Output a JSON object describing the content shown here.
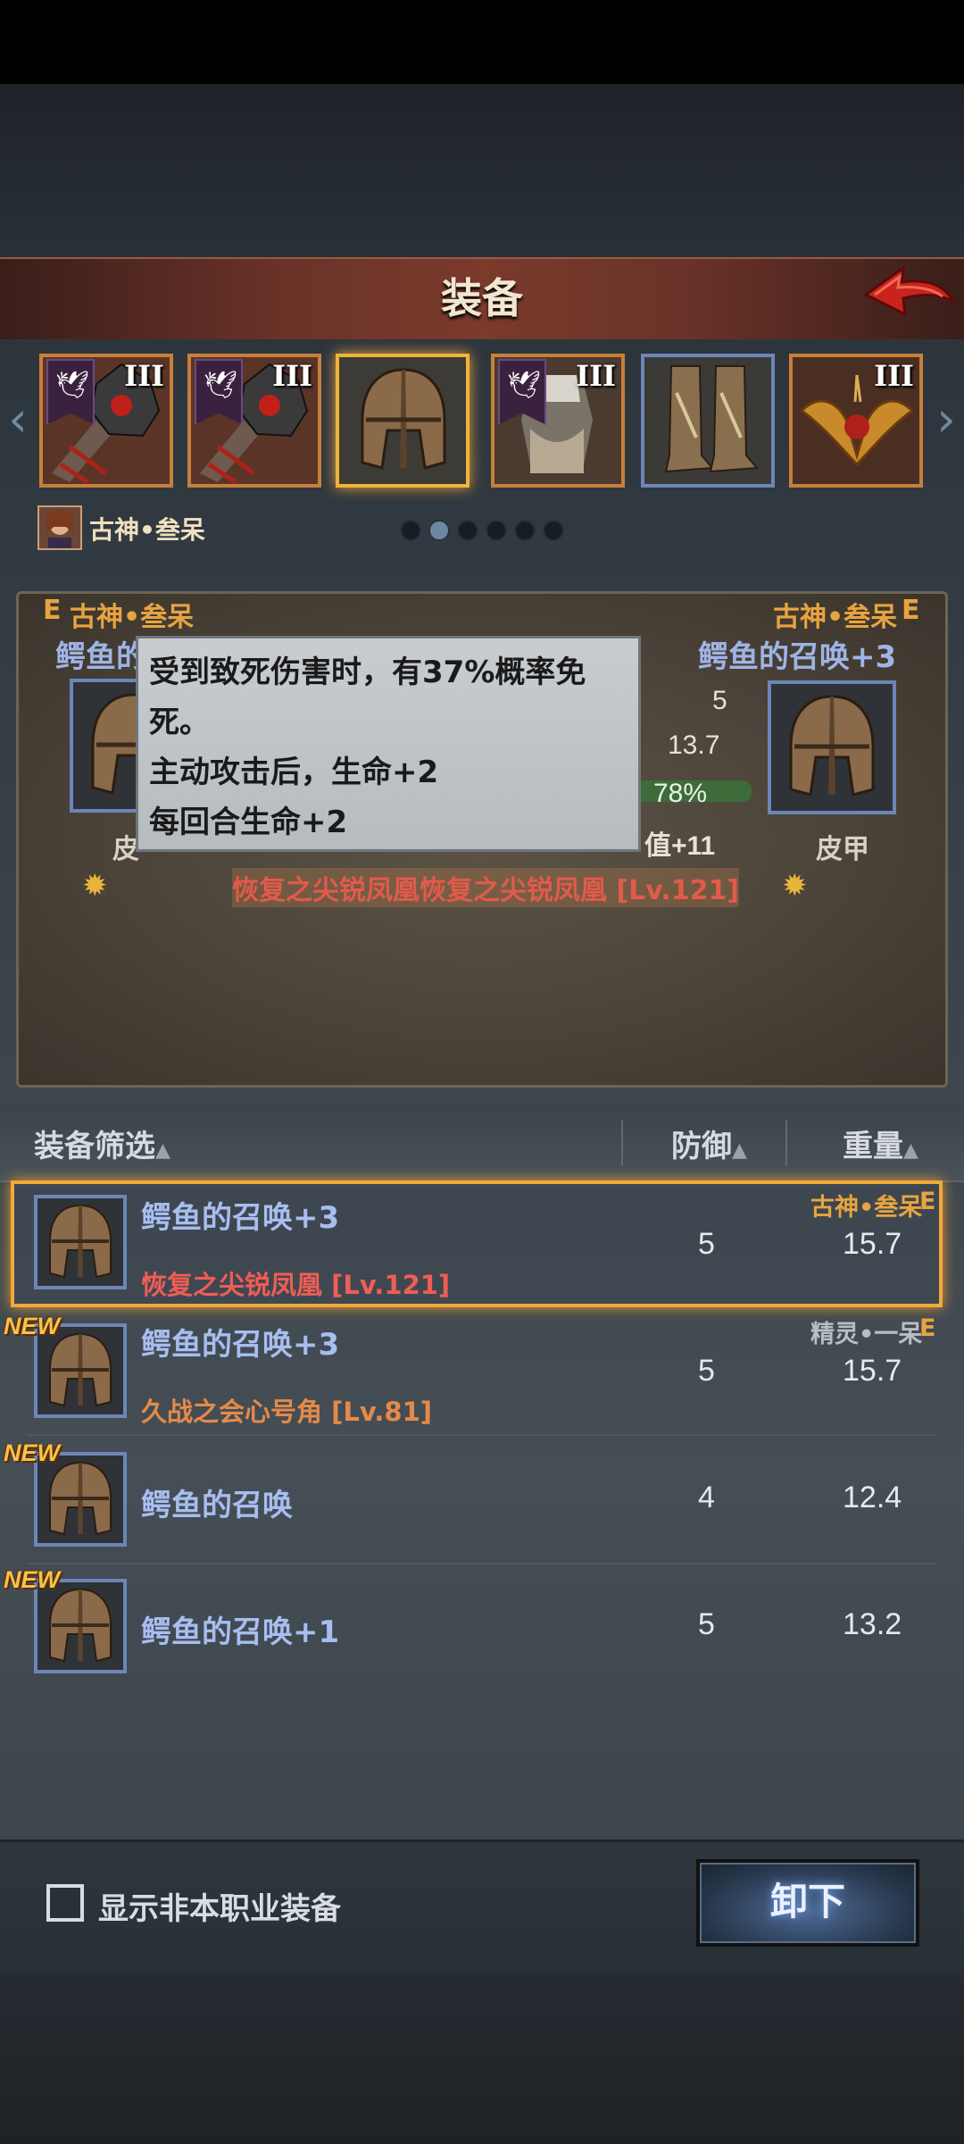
{
  "header": {
    "title": "装备"
  },
  "slots": [
    {
      "tier": "III",
      "banner": "dove",
      "item": "spiked-mace"
    },
    {
      "tier": "III",
      "banner": "dove",
      "item": "spiked-mace"
    },
    {
      "tier": "",
      "banner": "",
      "item": "helmet",
      "selected": true
    },
    {
      "tier": "III",
      "banner": "dove",
      "item": "fur-armor"
    },
    {
      "tier": "",
      "banner": "",
      "item": "boots"
    },
    {
      "tier": "III",
      "banner": "",
      "item": "bat-amulet"
    }
  ],
  "character": {
    "name": "古神•叁呆"
  },
  "pager": {
    "count": 6,
    "active": 1
  },
  "compare": {
    "left": {
      "grade": "E",
      "owner": "古神•叁呆",
      "name": "鳄鱼的",
      "type": "皮"
    },
    "right": {
      "grade": "E",
      "owner": "古神•叁呆",
      "name": "鳄鱼的召唤",
      "plus": "+3",
      "type": "皮甲"
    },
    "stats": [
      "5",
      "13.7",
      "78%",
      "值+11"
    ],
    "effect": "恢复之尖锐凤凰恢复之尖锐凤凰 [Lv.121]"
  },
  "tooltip": {
    "lines": [
      "受到致死伤害时，有37%概率免",
      "死。",
      "主动攻击后，生命+2",
      "每回合生命+2"
    ]
  },
  "list": {
    "headers": {
      "filter": "装备筛选",
      "defense": "防御",
      "weight": "重量"
    },
    "rows": [
      {
        "name": "鳄鱼的召唤",
        "plus": "+3",
        "sub": "恢复之尖锐凤凰 [Lv.121]",
        "defense": "5",
        "weight": "15.7",
        "owner": "古神•叁呆",
        "grade": "E",
        "new": "",
        "selected": true
      },
      {
        "name": "鳄鱼的召唤",
        "plus": "+3",
        "sub": "久战之会心号角 [Lv.81]",
        "defense": "5",
        "weight": "15.7",
        "owner": "精灵•一呆",
        "grade": "E",
        "new": "NEW"
      },
      {
        "name": "鳄鱼的召唤",
        "plus": "",
        "sub": "",
        "defense": "4",
        "weight": "12.4",
        "owner": "",
        "grade": "",
        "new": "NEW"
      },
      {
        "name": "鳄鱼的召唤",
        "plus": "+1",
        "sub": "",
        "defense": "5",
        "weight": "13.2",
        "owner": "",
        "grade": "",
        "new": "NEW"
      }
    ]
  },
  "footer": {
    "checkbox_label": "显示非本职业装备",
    "unequip_label": "卸下"
  },
  "colors": {
    "accent_orange": "#e8a440",
    "item_blue": "#a8bdf0",
    "title_bar": "#6b3328",
    "selected_border": "#f2a83a"
  }
}
